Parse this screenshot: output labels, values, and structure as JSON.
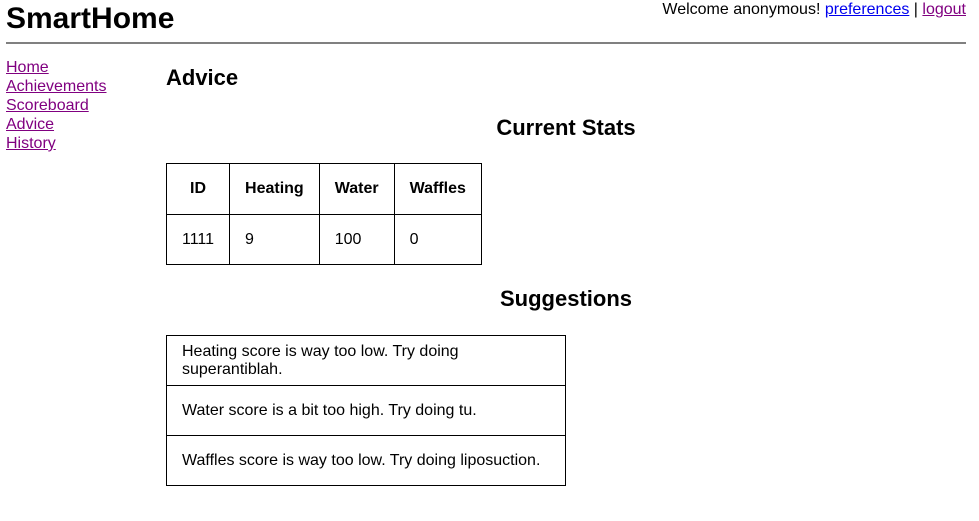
{
  "header": {
    "site_title": "SmartHome",
    "welcome_text": "Welcome anonymous!",
    "preferences_link": "preferences",
    "separator": "|",
    "logout_link": "logout"
  },
  "nav": {
    "items": [
      {
        "label": "Home"
      },
      {
        "label": "Achievements"
      },
      {
        "label": "Scoreboard"
      },
      {
        "label": "Advice"
      },
      {
        "label": "History"
      }
    ]
  },
  "main": {
    "page_heading": "Advice",
    "stats_title": "Current Stats",
    "stats_table": {
      "headers": [
        "ID",
        "Heating",
        "Water",
        "Waffles"
      ],
      "rows": [
        [
          "1111",
          "9",
          "100",
          "0"
        ]
      ]
    },
    "suggestions_title": "Suggestions",
    "suggestions": [
      "Heating score is way too low. Try doing superantiblah.",
      "Water score is a bit too high. Try doing tu.",
      "Waffles score is way too low. Try doing liposuction."
    ]
  },
  "colors": {
    "link_unvisited": "#0000ee",
    "link_visited": "#800080",
    "header_rule": "#808080"
  }
}
